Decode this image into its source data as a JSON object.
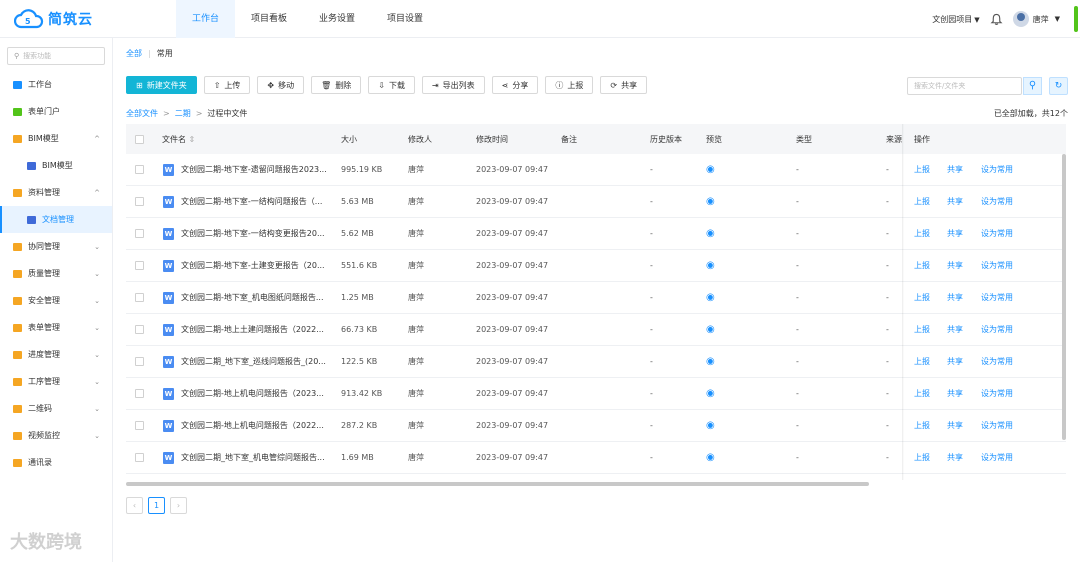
{
  "brand": {
    "name": "简筑云"
  },
  "topnav": [
    {
      "label": "工作台"
    },
    {
      "label": "项目看板"
    },
    {
      "label": "业务设置"
    },
    {
      "label": "项目设置"
    }
  ],
  "top_right": {
    "project": "文创园项目",
    "user": "唐萍"
  },
  "sidebar": {
    "search_placeholder": "搜索功能",
    "items": [
      {
        "label": "工作台"
      },
      {
        "label": "表单门户"
      },
      {
        "label": "BIM模型"
      },
      {
        "label": "BIM模型"
      },
      {
        "label": "资料管理"
      },
      {
        "label": "文档管理"
      },
      {
        "label": "协同管理"
      },
      {
        "label": "质量管理"
      },
      {
        "label": "安全管理"
      },
      {
        "label": "表单管理"
      },
      {
        "label": "进度管理"
      },
      {
        "label": "工序管理"
      },
      {
        "label": "二维码"
      },
      {
        "label": "视频监控"
      },
      {
        "label": "通讯录"
      }
    ]
  },
  "breadcrumb_top": {
    "all": "全部",
    "current": "常用"
  },
  "toolbar": {
    "new_folder": "新建文件夹",
    "upload": "上传",
    "move": "移动",
    "delete": "删除",
    "download": "下载",
    "export": "导出列表",
    "share": "分享",
    "report": "上报",
    "share2": "共享"
  },
  "search": {
    "placeholder": "搜索文件/文件夹"
  },
  "breadcrumb_path": {
    "root": "全部文件",
    "level2": "二期",
    "current": "过程中文件"
  },
  "loaded_text": "已全部加载，共12个",
  "table": {
    "headers": {
      "name": "文件名",
      "size": "大小",
      "modifier": "修改人",
      "mtime": "修改时间",
      "note": "备注",
      "history": "历史版本",
      "preview": "预览",
      "type": "类型",
      "source": "来源",
      "ops": "操作"
    },
    "op_labels": {
      "report": "上报",
      "share": "共享",
      "fav": "设为常用"
    },
    "rows": [
      {
        "name": "文创园二期-地下室-遗留问题报告2023...",
        "size": "995.19 KB",
        "modifier": "唐萍",
        "mtime": "2023-09-07 09:47",
        "history": "-",
        "type": "-",
        "source": "-"
      },
      {
        "name": "文创园二期-地下室-一结构问题报告（...",
        "size": "5.63 MB",
        "modifier": "唐萍",
        "mtime": "2023-09-07 09:47",
        "history": "-",
        "type": "-",
        "source": "-"
      },
      {
        "name": "文创园二期-地下室-一结构变更报告20...",
        "size": "5.62 MB",
        "modifier": "唐萍",
        "mtime": "2023-09-07 09:47",
        "history": "-",
        "type": "-",
        "source": "-"
      },
      {
        "name": "文创园二期-地下室-土建变更报告（20...",
        "size": "551.6 KB",
        "modifier": "唐萍",
        "mtime": "2023-09-07 09:47",
        "history": "-",
        "type": "-",
        "source": "-"
      },
      {
        "name": "文创园二期-地下室_机电图纸问题报告...",
        "size": "1.25 MB",
        "modifier": "唐萍",
        "mtime": "2023-09-07 09:47",
        "history": "-",
        "type": "-",
        "source": "-"
      },
      {
        "name": "文创园二期-地上土建问题报告（2022...",
        "size": "66.73 KB",
        "modifier": "唐萍",
        "mtime": "2023-09-07 09:47",
        "history": "-",
        "type": "-",
        "source": "-"
      },
      {
        "name": "文创园二期_地下室_巡线问题报告_(20...",
        "size": "122.5 KB",
        "modifier": "唐萍",
        "mtime": "2023-09-07 09:47",
        "history": "-",
        "type": "-",
        "source": "-"
      },
      {
        "name": "文创园二期-地上机电问题报告（2023...",
        "size": "913.42 KB",
        "modifier": "唐萍",
        "mtime": "2023-09-07 09:47",
        "history": "-",
        "type": "-",
        "source": "-"
      },
      {
        "name": "文创园二期-地上机电问题报告（2022...",
        "size": "287.2 KB",
        "modifier": "唐萍",
        "mtime": "2023-09-07 09:47",
        "history": "-",
        "type": "-",
        "source": "-"
      },
      {
        "name": "文创园二期_地下室_机电管综问题报告...",
        "size": "1.69 MB",
        "modifier": "唐萍",
        "mtime": "2023-09-07 09:47",
        "history": "-",
        "type": "-",
        "source": "-"
      }
    ]
  },
  "pagination": {
    "current": "1"
  },
  "watermark": "大数跨境",
  "colors": {
    "accent": "#1890ff",
    "primary_button": "#13b5d6"
  }
}
